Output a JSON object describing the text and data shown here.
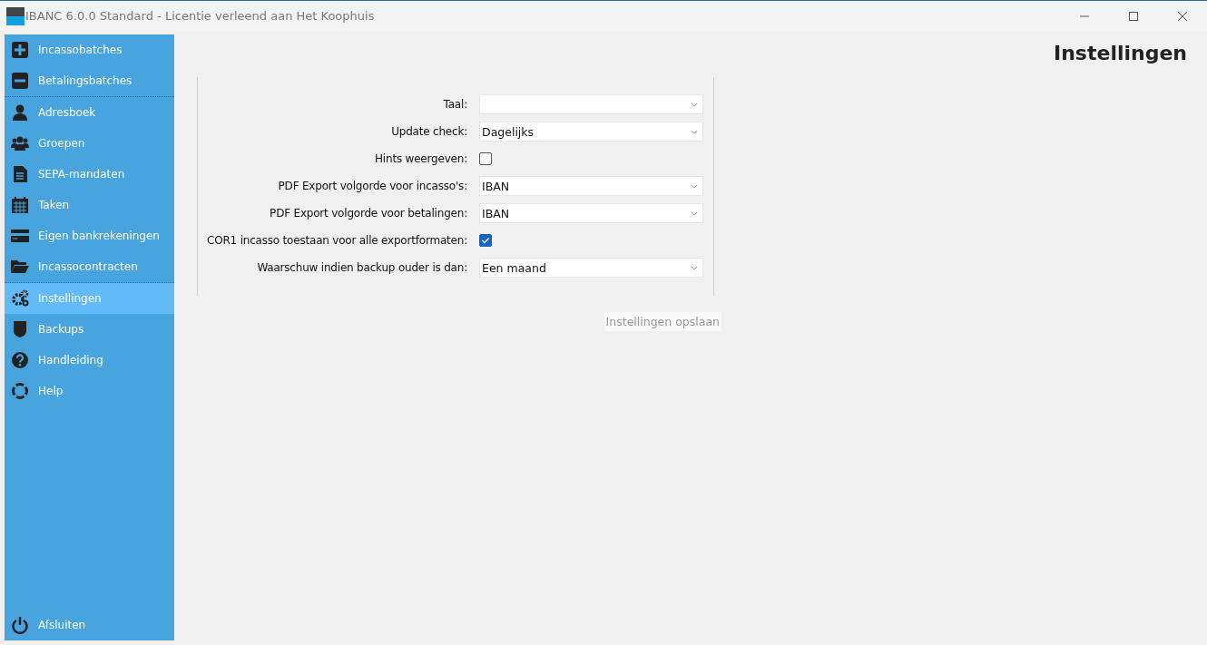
{
  "window": {
    "title": "IBANC 6.0.0 Standard - Licentie verleend aan Het Koophuis"
  },
  "sidebar": {
    "sections": [
      [
        {
          "label": "Incassobatches",
          "selected": false
        },
        {
          "label": "Betalingsbatches",
          "selected": false
        }
      ],
      [
        {
          "label": "Adresboek",
          "selected": false
        },
        {
          "label": "Groepen",
          "selected": false
        },
        {
          "label": "SEPA-mandaten",
          "selected": false
        },
        {
          "label": "Taken",
          "selected": false
        },
        {
          "label": "Eigen bankrekeningen",
          "selected": false
        },
        {
          "label": "Incassocontracten",
          "selected": false
        }
      ],
      [
        {
          "label": "Instellingen",
          "selected": true
        },
        {
          "label": "Backups",
          "selected": false
        },
        {
          "label": "Handleiding",
          "selected": false
        },
        {
          "label": "Help",
          "selected": false
        }
      ]
    ],
    "footer": {
      "label": "Afsluiten"
    }
  },
  "page": {
    "title": "Instellingen"
  },
  "settings": [
    {
      "kind": "select",
      "label": "Taal:"
    },
    {
      "kind": "select",
      "label": "Update check:",
      "value": "Dagelijks"
    },
    {
      "kind": "checkbox",
      "label": "Hints weergeven:",
      "checked": false
    },
    {
      "kind": "select",
      "label": "PDF Export volgorde voor incasso's:",
      "value": "IBAN"
    },
    {
      "kind": "select",
      "label": "PDF Export volgorde voor betalingen:",
      "value": "IBAN"
    },
    {
      "kind": "checkbox",
      "label": "COR1 incasso toestaan voor alle exportformaten:",
      "checked": true
    },
    {
      "kind": "select",
      "label": "Waarschuw indien backup ouder is dan:",
      "value": "Een maand"
    }
  ],
  "save_button": {
    "label": "Instellingen opslaan",
    "disabled": true
  }
}
